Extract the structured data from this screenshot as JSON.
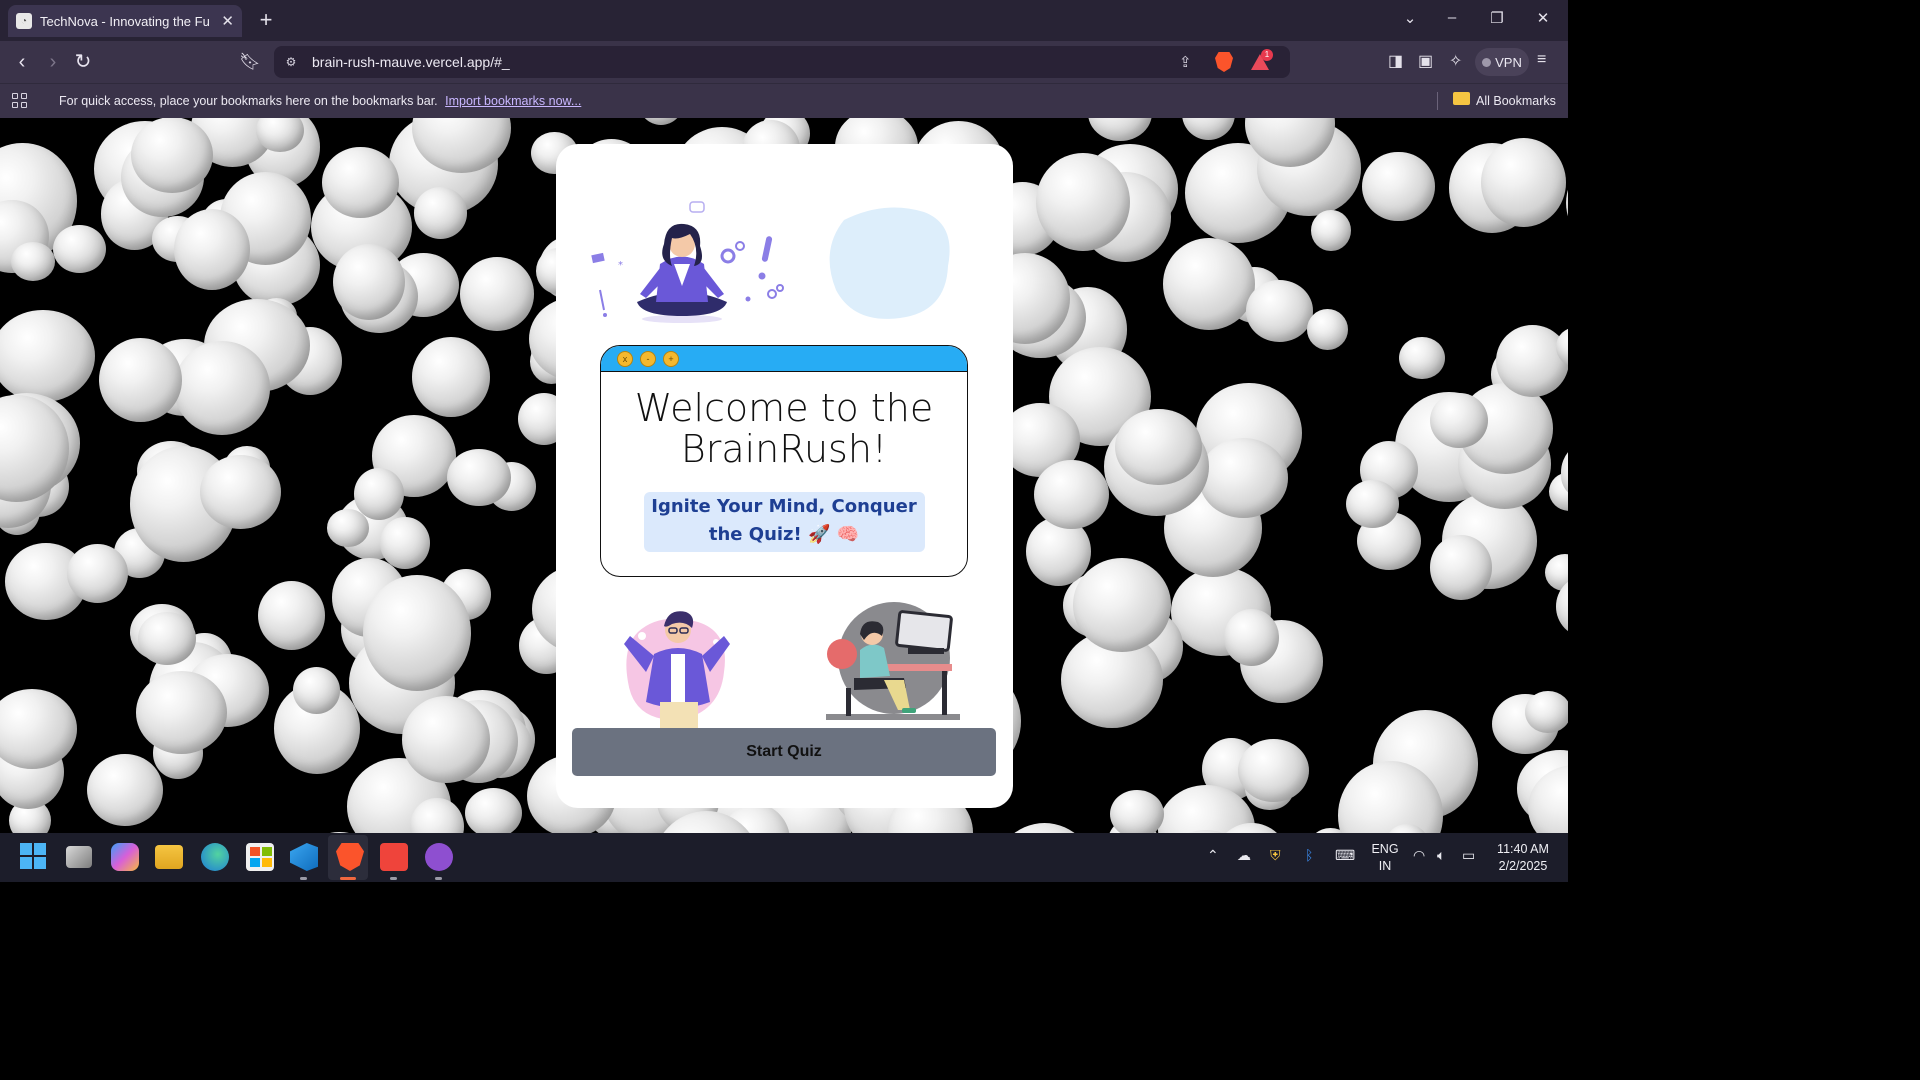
{
  "browser": {
    "tab_title": "TechNova - Innovating the Futu",
    "tab_close": "✕",
    "new_tab": "+",
    "url": "brain-rush-mauve.vercel.app/#_",
    "rewards_count": "1",
    "vpn_label": "VPN",
    "bookmarks_prompt": "For quick access, place your bookmarks here on the bookmarks bar.",
    "import_link": "Import bookmarks now...",
    "all_bookmarks": "All Bookmarks"
  },
  "page": {
    "welcome_title_line1": "Welcome to the",
    "welcome_title_line2": "BrainRush!",
    "tagline": "Ignite Your Mind, Conquer the Quiz! 🚀 🧠",
    "window_buttons": [
      "x",
      "-",
      "+"
    ],
    "start_button": "Start Quiz"
  },
  "taskbar": {
    "apps": [
      "windows-start",
      "task-view",
      "copilot",
      "file-explorer",
      "edge",
      "microsoft-store",
      "vscode",
      "brave",
      "anydesk",
      "github-desktop"
    ],
    "language_line1": "ENG",
    "language_line2": "IN",
    "time": "11:40 AM",
    "date": "2/2/2025"
  },
  "colors": {
    "window_bar": "#27acf4",
    "tagline_bg": "#dbe9fc",
    "tagline_text": "#1e3f93",
    "start_button_bg": "#6b7280"
  }
}
